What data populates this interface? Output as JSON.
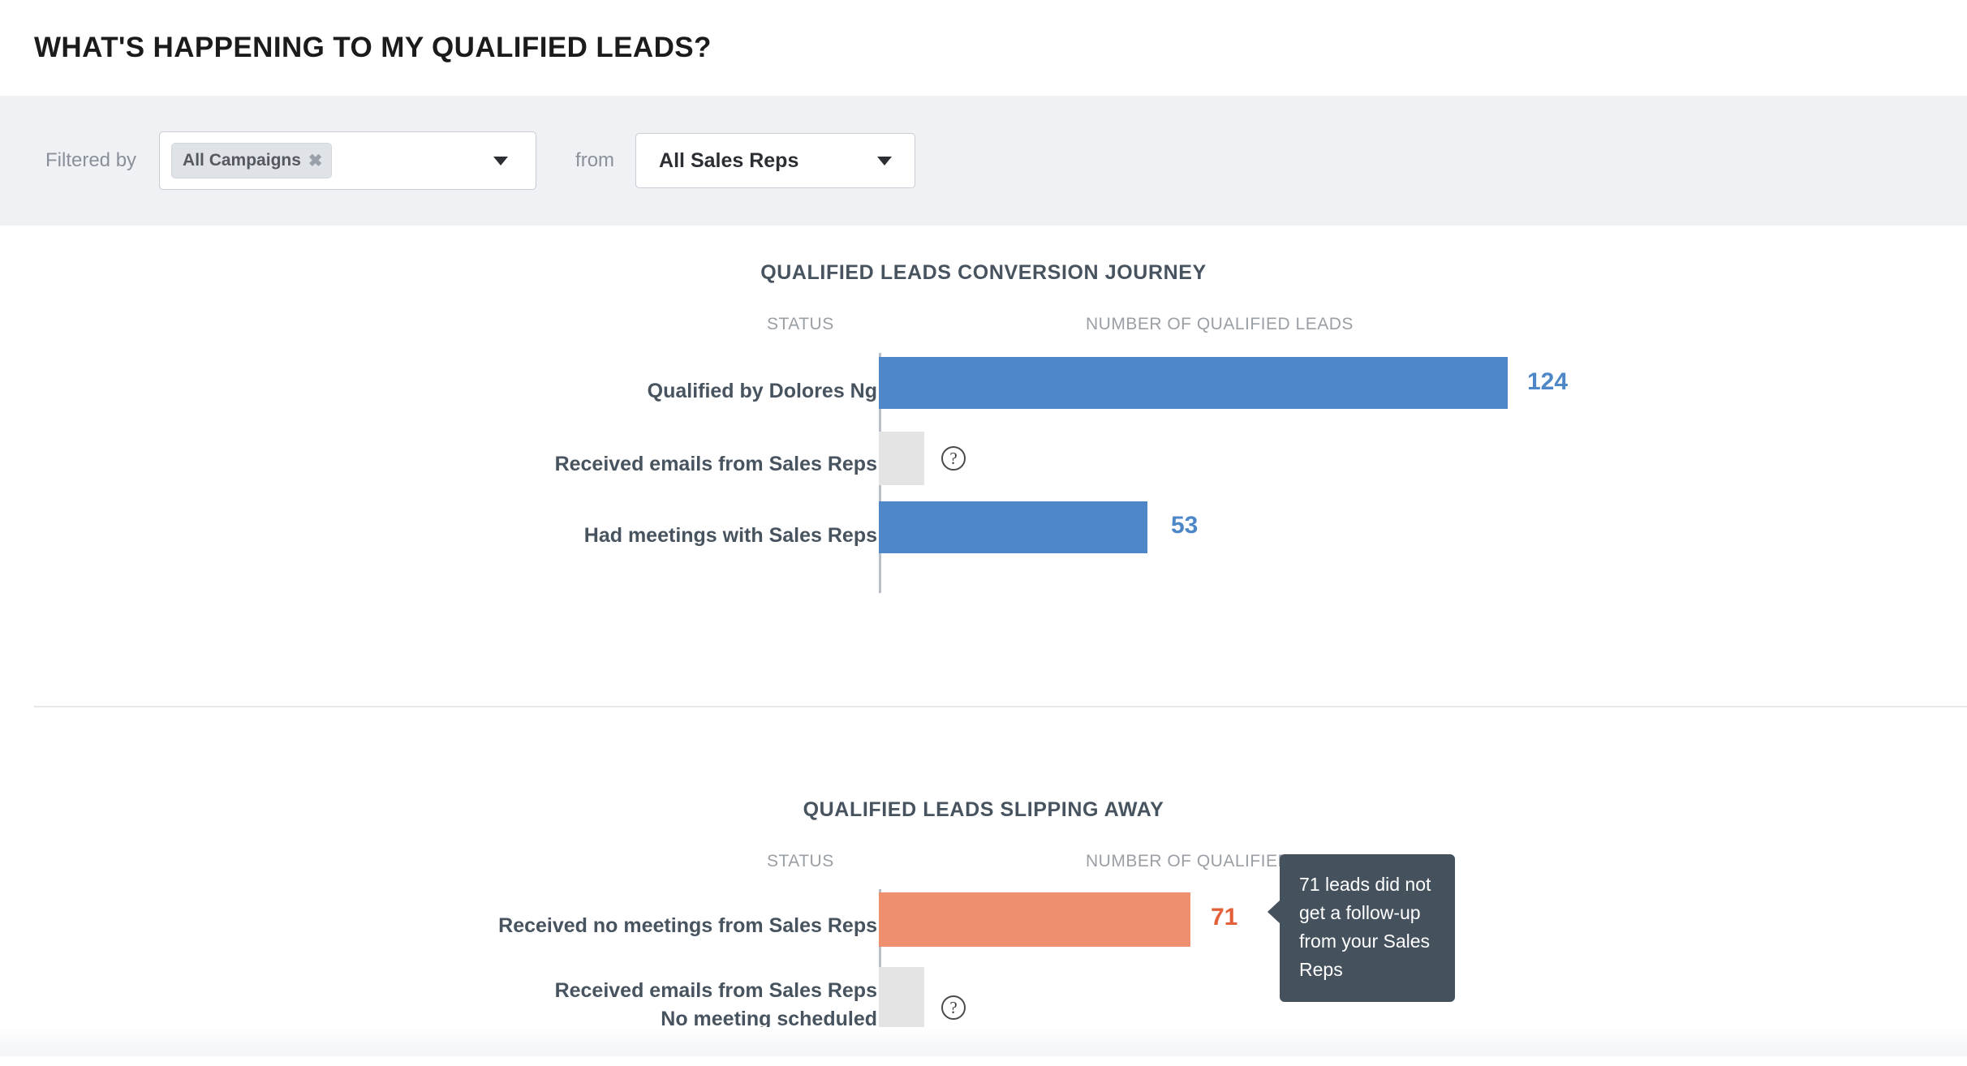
{
  "header": {
    "title": "WHAT'S HAPPENING TO MY QUALIFIED LEADS?"
  },
  "filter_bar": {
    "filtered_by_label": "Filtered by",
    "from_label": "from",
    "campaign_select": {
      "chip_label": "All Campaigns",
      "chip_remove_icon": "close-icon",
      "caret_icon": "chevron-down-icon"
    },
    "sales_rep_select": {
      "value": "All Sales Reps",
      "caret_icon": "chevron-down-icon"
    }
  },
  "colors": {
    "blue": "#4d87c7",
    "orange": "#ee8f70",
    "orange_text": "#e3613a",
    "placeholder_gray": "#e4e4e4",
    "label_text": "#47535e",
    "header_text": "#9a9fa5",
    "tooltip_bg": "#45525e",
    "filter_bar_bg": "#eff1f5"
  },
  "tooltip": {
    "text": "71 leads did not get a follow-up from your Sales Reps"
  },
  "chart_data": [
    {
      "type": "bar",
      "title": "QUALIFIED LEADS CONVERSION JOURNEY",
      "orientation": "horizontal",
      "xlabel": "NUMBER OF QUALIFIED LEADS",
      "ylabel": "STATUS",
      "xlim": [
        0,
        124
      ],
      "grid": false,
      "legend": "none",
      "categories": [
        "Qualified by Dolores Ng",
        "Received emails from Sales Reps",
        "Had meetings with Sales Reps"
      ],
      "values": [
        124,
        null,
        53
      ],
      "value_labels": [
        "124",
        "",
        "53"
      ],
      "bar_styles": [
        "blue",
        "placeholder",
        "blue"
      ],
      "placeholder_help_icon": "help-circle-icon"
    },
    {
      "type": "bar",
      "title": "QUALIFIED LEADS SLIPPING AWAY",
      "orientation": "horizontal",
      "xlabel": "NUMBER OF QUALIFIED LEADS",
      "ylabel": "STATUS",
      "xlim": [
        0,
        124
      ],
      "grid": false,
      "legend": "none",
      "categories": [
        "Received no meetings from Sales Reps",
        "Received emails from Sales Reps\nNo meeting scheduled"
      ],
      "values": [
        71,
        null
      ],
      "value_labels": [
        "71",
        ""
      ],
      "bar_styles": [
        "orange",
        "placeholder"
      ],
      "placeholder_help_icon": "help-circle-icon"
    }
  ],
  "chart1": {
    "title": "QUALIFIED LEADS CONVERSION JOURNEY",
    "col_status": "STATUS",
    "col_value": "NUMBER OF QUALIFIED LEADS",
    "rows": [
      {
        "label": "Qualified by Dolores Ng",
        "value": "124"
      },
      {
        "label": "Received emails from Sales Reps",
        "value": ""
      },
      {
        "label": "Had meetings with Sales Reps",
        "value": "53"
      }
    ]
  },
  "chart2": {
    "title": "QUALIFIED LEADS SLIPPING AWAY",
    "col_status": "STATUS",
    "col_value": "NUMBER OF QUALIFIED LEADS",
    "rows": [
      {
        "label": "Received no meetings from Sales Reps",
        "value": "71"
      },
      {
        "label_line1": "Received emails from Sales Reps",
        "label_line2": "No meeting scheduled",
        "value": ""
      }
    ]
  }
}
